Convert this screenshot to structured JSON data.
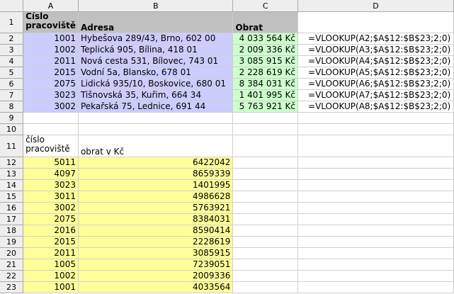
{
  "columns": [
    "A",
    "B",
    "C",
    "D"
  ],
  "header": {
    "row": "1",
    "a": "Číslo pracoviště",
    "b": "Adresa",
    "c": "Obrat"
  },
  "records": [
    {
      "row": "2",
      "id": "1001",
      "address": "Hybešova 289/43, Brno, 602 00",
      "turnover": "4 033 564 Kč",
      "formula": "=VLOOKUP(A2;$A$12:$B$23;2;0)"
    },
    {
      "row": "3",
      "id": "1002",
      "address": "Teplická 905, Bílina, 418 01",
      "turnover": "2 009 336 Kč",
      "formula": "=VLOOKUP(A3;$A$12:$B$23;2;0)"
    },
    {
      "row": "4",
      "id": "2011",
      "address": "Nová cesta 531, Bílovec, 743 01",
      "turnover": "3 085 915 Kč",
      "formula": "=VLOOKUP(A4;$A$12:$B$23;2;0)"
    },
    {
      "row": "5",
      "id": "2015",
      "address": "Vodní 5a, Blansko, 678 01",
      "turnover": "2 228 619 Kč",
      "formula": "=VLOOKUP(A5;$A$12:$B$23;2;0)"
    },
    {
      "row": "6",
      "id": "2075",
      "address": "Lidická 935/10, Boskovice, 680 01",
      "turnover": "8 384 031 Kč",
      "formula": "=VLOOKUP(A6;$A$12:$B$23;2;0)"
    },
    {
      "row": "7",
      "id": "3023",
      "address": "Tišnovská 35, Kuřim, 664 34",
      "turnover": "1 401 995 Kč",
      "formula": "=VLOOKUP(A7;$A$12:$B$23;2;0)"
    },
    {
      "row": "8",
      "id": "3002",
      "address": "Pekařská 75, Lednice, 691 44",
      "turnover": "5 763 921 Kč",
      "formula": "=VLOOKUP(A8;$A$12:$B$23;2;0)"
    }
  ],
  "blank_rows": [
    "9",
    "10"
  ],
  "lookup_header": {
    "row": "11",
    "a": "číslo pracoviště",
    "b": "obrat v Kč"
  },
  "lookup": [
    {
      "row": "12",
      "id": "5011",
      "value": "6422042"
    },
    {
      "row": "13",
      "id": "4097",
      "value": "8659339"
    },
    {
      "row": "14",
      "id": "3023",
      "value": "1401995"
    },
    {
      "row": "15",
      "id": "3011",
      "value": "4986628"
    },
    {
      "row": "16",
      "id": "3002",
      "value": "5763921"
    },
    {
      "row": "17",
      "id": "2075",
      "value": "8384031"
    },
    {
      "row": "18",
      "id": "2016",
      "value": "8590414"
    },
    {
      "row": "19",
      "id": "2015",
      "value": "2228619"
    },
    {
      "row": "20",
      "id": "2011",
      "value": "3085915"
    },
    {
      "row": "21",
      "id": "1005",
      "value": "7239051"
    },
    {
      "row": "22",
      "id": "1002",
      "value": "2009336"
    },
    {
      "row": "23",
      "id": "1001",
      "value": "4033564"
    }
  ],
  "colors": {
    "header_gray": "#c0c0c0",
    "blue_fill": "#ccccff",
    "green_fill": "#ccffcc",
    "yellow_fill": "#ffff99",
    "headings_bg": "#eeeeee"
  }
}
